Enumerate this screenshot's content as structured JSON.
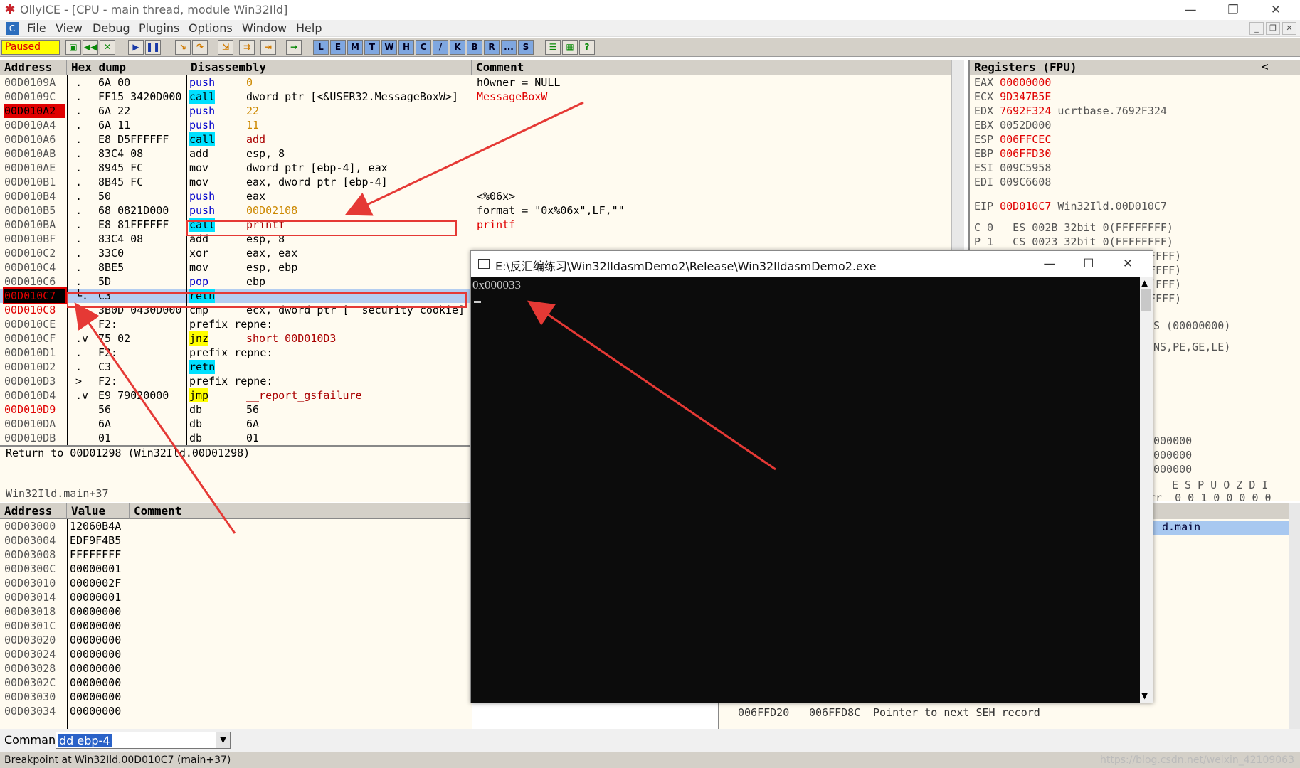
{
  "titlebar": {
    "title": "OllyICE - [CPU - main thread, module Win32Ild]",
    "min": "—",
    "restore": "❐",
    "close": "✕"
  },
  "menu": [
    "File",
    "View",
    "Debug",
    "Plugins",
    "Options",
    "Window",
    "Help"
  ],
  "toolbar": {
    "status": "Paused",
    "letters": [
      "L",
      "E",
      "M",
      "T",
      "W",
      "H",
      "C",
      "/",
      "K",
      "B",
      "R",
      "...",
      "S"
    ]
  },
  "disasm": {
    "headers": [
      "Address",
      "Hex dump",
      "Disassembly",
      "Comment"
    ],
    "rows": [
      {
        "addr": "00D0109A",
        "mark": ".",
        "hex": "6A 00",
        "mn": "push",
        "op": "0",
        "cm": "hOwner = NULL"
      },
      {
        "addr": "00D0109C",
        "mark": ".",
        "hex": "FF15 3420D000",
        "mn": "call",
        "op": "dword ptr [<&USER32.MessageBoxW>]",
        "cm": "MessageBoxW"
      },
      {
        "addr": "00D010A2",
        "mark": ".",
        "hex": "6A 22",
        "mn": "push",
        "op": "22",
        "cm": ""
      },
      {
        "addr": "00D010A4",
        "mark": ".",
        "hex": "6A 11",
        "mn": "push",
        "op": "11",
        "cm": ""
      },
      {
        "addr": "00D010A6",
        "mark": ".",
        "hex": "E8 D5FFFFFF",
        "mn": "call",
        "op": "add",
        "cm": ""
      },
      {
        "addr": "00D010AB",
        "mark": ".",
        "hex": "83C4 08",
        "mn": "add",
        "op": "esp, 8",
        "cm": ""
      },
      {
        "addr": "00D010AE",
        "mark": ".",
        "hex": "8945 FC",
        "mn": "mov",
        "op": "dword ptr [ebp-4], eax",
        "cm": ""
      },
      {
        "addr": "00D010B1",
        "mark": ".",
        "hex": "8B45 FC",
        "mn": "mov",
        "op": "eax, dword ptr [ebp-4]",
        "cm": ""
      },
      {
        "addr": "00D010B4",
        "mark": ".",
        "hex": "50",
        "mn": "push",
        "op": "eax",
        "cm": "<%06x>"
      },
      {
        "addr": "00D010B5",
        "mark": ".",
        "hex": "68 0821D000",
        "mn": "push",
        "op": "00D02108",
        "cm": "format = \"0x%06x\",LF,\"\""
      },
      {
        "addr": "00D010BA",
        "mark": ".",
        "hex": "E8 81FFFFFF",
        "mn": "call",
        "op": "printf",
        "cm": "printf"
      },
      {
        "addr": "00D010BF",
        "mark": ".",
        "hex": "83C4 08",
        "mn": "add",
        "op": "esp, 8",
        "cm": ""
      },
      {
        "addr": "00D010C2",
        "mark": ".",
        "hex": "33C0",
        "mn": "xor",
        "op": "eax, eax",
        "cm": ""
      },
      {
        "addr": "00D010C4",
        "mark": ".",
        "hex": "8BE5",
        "mn": "mov",
        "op": "esp, ebp",
        "cm": ""
      },
      {
        "addr": "00D010C6",
        "mark": ".",
        "hex": "5D",
        "mn": "pop",
        "op": "ebp",
        "cm": ""
      },
      {
        "addr": "00D010C7",
        "mark": "└.",
        "hex": "C3",
        "mn": "retn",
        "op": "",
        "cm": ""
      },
      {
        "addr": "00D010C8",
        "mark": "",
        "hex": "3B0D 0430D000",
        "mn": "cmp",
        "op": "ecx, dword ptr [__security_cookie]",
        "cm": ""
      },
      {
        "addr": "00D010CE",
        "mark": ".",
        "hex": "F2:",
        "mn": "prefix repne:",
        "op": "",
        "cm": ""
      },
      {
        "addr": "00D010CF",
        "mark": ".v",
        "hex": "75 02",
        "mn": "jnz",
        "op": "short 00D010D3",
        "cm": ""
      },
      {
        "addr": "00D010D1",
        "mark": ".",
        "hex": "F2:",
        "mn": "prefix repne:",
        "op": "",
        "cm": ""
      },
      {
        "addr": "00D010D2",
        "mark": ".",
        "hex": "C3",
        "mn": "retn",
        "op": "",
        "cm": ""
      },
      {
        "addr": "00D010D3",
        "mark": ">",
        "hex": "F2:",
        "mn": "prefix repne:",
        "op": "",
        "cm": ""
      },
      {
        "addr": "00D010D4",
        "mark": ".v",
        "hex": "E9 79020000",
        "mn": "jmp",
        "op": "__report_gsfailure",
        "cm": ""
      },
      {
        "addr": "00D010D9",
        "mark": "",
        "hex": "56",
        "mn": "db",
        "op": "56",
        "cm": ""
      },
      {
        "addr": "00D010DA",
        "mark": "",
        "hex": "6A",
        "mn": "db",
        "op": "6A",
        "cm": ""
      },
      {
        "addr": "00D010DB",
        "mark": "",
        "hex": "01",
        "mn": "db",
        "op": "01",
        "cm": ""
      }
    ]
  },
  "info": {
    "line1": "Return to 00D01298 (Win32Ild.00D01298)",
    "line2": "Win32Ild.main+37"
  },
  "registers": {
    "header": "Registers (FPU)",
    "rows": [
      {
        "n": "EAX",
        "v": "00000000",
        "d": ""
      },
      {
        "n": "ECX",
        "v": "9D347B5E",
        "d": ""
      },
      {
        "n": "EDX",
        "v": "7692F324",
        "d": "ucrtbase.7692F324"
      },
      {
        "n": "EBX",
        "v": "0052D000",
        "d": ""
      },
      {
        "n": "ESP",
        "v": "006FFCEC",
        "d": ""
      },
      {
        "n": "EBP",
        "v": "006FFD30",
        "d": ""
      },
      {
        "n": "ESI",
        "v": "009C5958",
        "d": ""
      },
      {
        "n": "EDI",
        "v": "009C6608",
        "d": ""
      }
    ],
    "eip": {
      "n": "EIP",
      "v": "00D010C7",
      "d": "Win32Ild.00D010C7"
    },
    "seg": [
      "C 0   ES 002B 32bit 0(FFFFFFFF)",
      "P 1   CS 0023 32bit 0(FFFFFFFF)"
    ],
    "partial": [
      "FFFF)",
      "FFFF)",
      "(FFF)",
      "FFFF)"
    ],
    "mid1": "S (00000000)",
    "mid2": "NS,PE,GE,LE)",
    "low": [
      "000000",
      "000000",
      "000000"
    ],
    "flagsHdr": "E S P U O Z D I",
    "flagsVal": "rr  0 0 1 0 0 0 0 0"
  },
  "dump": {
    "headers": [
      "Address",
      "Value",
      "Comment"
    ],
    "rows": [
      {
        "a": "00D03000",
        "v": "12060B4A"
      },
      {
        "a": "00D03004",
        "v": "EDF9F4B5"
      },
      {
        "a": "00D03008",
        "v": "FFFFFFFF"
      },
      {
        "a": "00D0300C",
        "v": "00000001"
      },
      {
        "a": "00D03010",
        "v": "0000002F"
      },
      {
        "a": "00D03014",
        "v": "00000001"
      },
      {
        "a": "00D03018",
        "v": "00000000"
      },
      {
        "a": "00D0301C",
        "v": "00000000"
      },
      {
        "a": "00D03020",
        "v": "00000000"
      },
      {
        "a": "00D03024",
        "v": "00000000"
      },
      {
        "a": "00D03028",
        "v": "00000000"
      },
      {
        "a": "00D0302C",
        "v": "00000000"
      },
      {
        "a": "00D03030",
        "v": "00000000"
      },
      {
        "a": "00D03034",
        "v": "00000000"
      }
    ]
  },
  "stack": {
    "selected": "d.main",
    "rowAddr": "006FFD20",
    "rowVal": "006FFD8C",
    "rowComment": "Pointer to next SEH record"
  },
  "console": {
    "title": "E:\\反汇编练习\\Win32IldasmDemo2\\Release\\Win32IldasmDemo2.exe",
    "output": "0x000033"
  },
  "command": {
    "label": "Command",
    "value": "dd ebp-4"
  },
  "status": "Breakpoint at Win32Ild.00D010C7 (main+37)",
  "watermark": "https://blog.csdn.net/weixin_42109063",
  "colors": {
    "accent_red": "#e00000",
    "highlight_cyan": "#00e0ff",
    "highlight_yellow": "#ffff00"
  }
}
